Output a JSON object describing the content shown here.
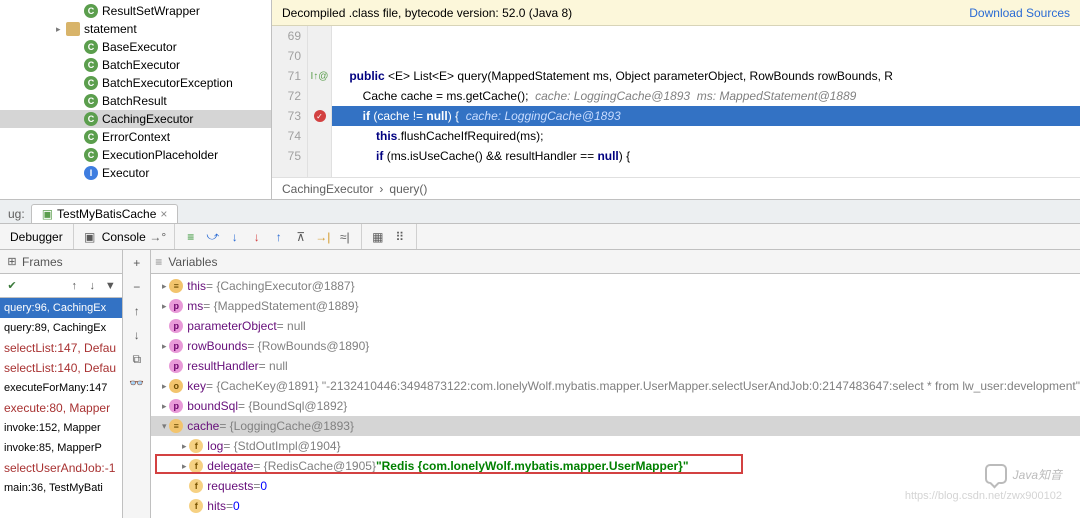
{
  "tree": {
    "items": [
      {
        "indent": 70,
        "exp": "",
        "icon": "C",
        "ic": "ic-class",
        "label": "ResultSetWrapper"
      },
      {
        "indent": 52,
        "exp": "▸",
        "icon": "",
        "ic": "ic-folder",
        "label": "statement"
      },
      {
        "indent": 70,
        "exp": "",
        "icon": "C",
        "ic": "ic-class",
        "label": "BaseExecutor"
      },
      {
        "indent": 70,
        "exp": "",
        "icon": "C",
        "ic": "ic-class",
        "label": "BatchExecutor"
      },
      {
        "indent": 70,
        "exp": "",
        "icon": "C",
        "ic": "ic-class",
        "label": "BatchExecutorException"
      },
      {
        "indent": 70,
        "exp": "",
        "icon": "C",
        "ic": "ic-class",
        "label": "BatchResult"
      },
      {
        "indent": 70,
        "exp": "",
        "icon": "C",
        "ic": "ic-class",
        "label": "CachingExecutor",
        "selected": true
      },
      {
        "indent": 70,
        "exp": "",
        "icon": "C",
        "ic": "ic-class",
        "label": "ErrorContext"
      },
      {
        "indent": 70,
        "exp": "",
        "icon": "C",
        "ic": "ic-class",
        "label": "ExecutionPlaceholder"
      },
      {
        "indent": 70,
        "exp": "",
        "icon": "I",
        "ic": "ic-interface",
        "label": "Executor"
      }
    ]
  },
  "banner": {
    "text": "Decompiled .class file, bytecode version: 52.0 (Java 8)",
    "link": "Download Sources"
  },
  "code": {
    "lines": [
      {
        "n": "69",
        "html": ""
      },
      {
        "n": "70",
        "html": ""
      },
      {
        "n": "71",
        "mark": "impl",
        "html": "    <span class='kw'>public</span> &lt;E&gt; List&lt;E&gt; query(MappedStatement ms, Object parameterObject, RowBounds rowBounds, R"
      },
      {
        "n": "72",
        "html": "        Cache cache = ms.getCache();  <span class='cm'>cache: LoggingCache@1893  ms: MappedStatement@1889</span>"
      },
      {
        "n": "73",
        "mark": "bp",
        "exec": true,
        "html": "        <span class='kw'>if</span> (cache != <span class='kw'>null</span>) {  <span class='cm'>cache: LoggingCache@1893</span>"
      },
      {
        "n": "74",
        "html": "            <span class='kw'>this</span>.flushCacheIfRequired(ms);"
      },
      {
        "n": "75",
        "html": "            <span class='kw'>if</span> (ms.isUseCache() && resultHandler == <span class='kw'>null</span>) {"
      }
    ]
  },
  "breadcrumb": {
    "a": "CachingExecutor",
    "b": "query()"
  },
  "debug": {
    "sideLabel": "ug:",
    "tabLabel": "TestMyBatisCache",
    "debuggerLabel": "Debugger",
    "consoleLabel": "Console"
  },
  "frames": {
    "title": "Frames",
    "items": [
      {
        "label": "query:96, CachingEx",
        "sel": true
      },
      {
        "label": "query:89, CachingEx"
      },
      {
        "label": "selectList:147, Defau",
        "red": true
      },
      {
        "label": "selectList:140, Defau",
        "red": true
      },
      {
        "label": "executeForMany:147"
      },
      {
        "label": "execute:80, Mapper",
        "red": true
      },
      {
        "label": "invoke:152, Mapper"
      },
      {
        "label": "invoke:85, MapperP"
      },
      {
        "label": "selectUserAndJob:-1",
        "red": true
      },
      {
        "label": "main:36, TestMyBati"
      }
    ]
  },
  "vars": {
    "title": "Variables",
    "items": [
      {
        "indent": 0,
        "exp": "▸",
        "icon": "≡",
        "ic": "vi-eq",
        "name": "this",
        "rest": " = {CachingExecutor@1887}"
      },
      {
        "indent": 0,
        "exp": "▸",
        "icon": "p",
        "ic": "vi-p",
        "name": "ms",
        "rest": " = {MappedStatement@1889}"
      },
      {
        "indent": 0,
        "exp": "",
        "icon": "p",
        "ic": "vi-p",
        "name": "parameterObject",
        "rest": " = null"
      },
      {
        "indent": 0,
        "exp": "▸",
        "icon": "p",
        "ic": "vi-p",
        "name": "rowBounds",
        "rest": " = {RowBounds@1890}"
      },
      {
        "indent": 0,
        "exp": "",
        "icon": "p",
        "ic": "vi-p",
        "name": "resultHandler",
        "rest": " = null"
      },
      {
        "indent": 0,
        "exp": "▸",
        "icon": "o",
        "ic": "vi-o",
        "name": "key",
        "rest": " = {CacheKey@1891} \"-2132410446:3494873122:com.lonelyWolf.mybatis.mapper.UserMapper.selectUserAndJob:0:2147483647:select * from lw_user:development\""
      },
      {
        "indent": 0,
        "exp": "▸",
        "icon": "p",
        "ic": "vi-p",
        "name": "boundSql",
        "rest": " = {BoundSql@1892}"
      },
      {
        "indent": 0,
        "exp": "▾",
        "icon": "≡",
        "ic": "vi-eq",
        "name": "cache",
        "rest": " = {LoggingCache@1893}",
        "sel": true
      },
      {
        "indent": 1,
        "exp": "▸",
        "icon": "f",
        "ic": "vi-f",
        "name": "log",
        "rest": " = {StdOutImpl@1904}"
      },
      {
        "indent": 1,
        "exp": "▸",
        "icon": "f",
        "ic": "vi-f",
        "name": "delegate",
        "rest": " = {RedisCache@1905} ",
        "str": "\"Redis {com.lonelyWolf.mybatis.mapper.UserMapper}\"",
        "hl": true
      },
      {
        "indent": 1,
        "exp": "",
        "icon": "f",
        "ic": "vi-f",
        "name": "requests",
        "rest": " = ",
        "num": "0"
      },
      {
        "indent": 1,
        "exp": "",
        "icon": "f",
        "ic": "vi-f",
        "name": "hits",
        "rest": " = ",
        "num": "0"
      }
    ]
  },
  "watermark": {
    "text": "Java知音",
    "url": "https://blog.csdn.net/zwx900102"
  },
  "chart_data": {
    "type": "table",
    "note": "no chart in image"
  }
}
